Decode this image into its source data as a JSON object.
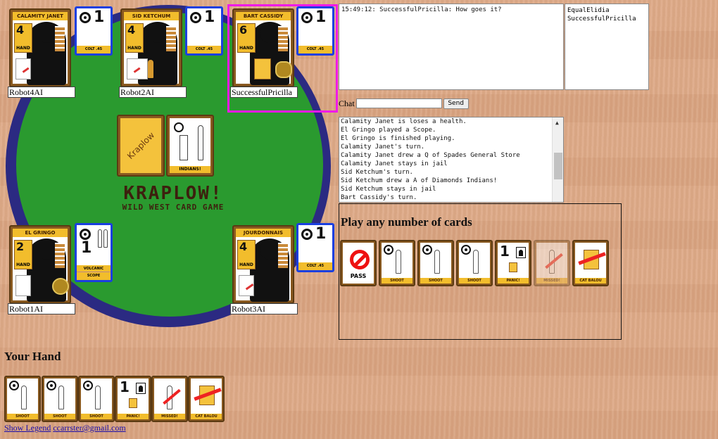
{
  "players": {
    "robot4": {
      "character": "CALAMITY JANET",
      "life": "4",
      "hand_label": "HAND",
      "name": "Robot4AI",
      "gun": "COLT .45",
      "range": "1"
    },
    "robot2": {
      "character": "SID KETCHUM",
      "life": "4",
      "hand_label": "HAND",
      "name": "Robot2AI",
      "gun": "COLT .45",
      "range": "1"
    },
    "me": {
      "character": "BART CASSIDY",
      "life": "6",
      "hand_label": "HAND",
      "name": "SuccessfulPricilla",
      "gun": "COLT .45",
      "range": "1"
    },
    "robot1": {
      "character": "EL GRINGO",
      "life": "2",
      "hand_label": "HAND",
      "name": "Robot1AI",
      "gun_top": "VOLCANIC",
      "gun_bottom": "SCOPE",
      "range": "1"
    },
    "robot3": {
      "character": "JOURDONNAIS",
      "life": "4",
      "hand_label": "HAND",
      "name": "Robot3AI",
      "gun": "COLT .45",
      "range": "1"
    }
  },
  "table": {
    "deck_label": "Kraplow",
    "discard_footer": "INDIANS!",
    "logo_title": "KRAPLOW!",
    "logo_subtitle": "WILD WEST CARD GAME"
  },
  "chat": {
    "messages": "15:49:12: SuccessfulPricilla: How goes it?",
    "users": [
      "EqualElidia",
      "SuccessfulPricilla"
    ],
    "label": "Chat",
    "input_value": "",
    "send_label": "Send"
  },
  "log": [
    "Calamity Janet is loses a health.",
    "El Gringo played a Scope.",
    "El Gringo is finished playing.",
    "Calamity Janet's turn.",
    "Calamity Janet drew a Q of Spades General Store",
    "Calamity Janet stays in jail",
    "Sid Ketchum's turn.",
    "Sid Ketchum drew a A of Diamonds Indians!",
    "Sid Ketchum stays in jail",
    "Bart Cassidy's turn."
  ],
  "action": {
    "title": "Play any number of cards",
    "cards": [
      {
        "label": "PASS"
      },
      {
        "label": "SHOOT"
      },
      {
        "label": "SHOOT"
      },
      {
        "label": "SHOOT"
      },
      {
        "label": "PANIC!"
      },
      {
        "label": "MISSED!"
      },
      {
        "label": "CAT BALOU"
      }
    ]
  },
  "hand": {
    "title": "Your Hand",
    "cards": [
      {
        "label": "SHOOT"
      },
      {
        "label": "SHOOT"
      },
      {
        "label": "SHOOT"
      },
      {
        "label": "PANIC!"
      },
      {
        "label": "MISSED!"
      },
      {
        "label": "CAT BALOU"
      }
    ]
  },
  "footer": {
    "legend_link": "Show Legend",
    "email_link": "ccarrster@gmail.com"
  },
  "colors": {
    "felt": "#2a9a2f",
    "rim": "#2b2a82",
    "highlight": "#f01ae8",
    "gun_border": "#1a3fe0",
    "card_yellow": "#f2bd2c"
  }
}
